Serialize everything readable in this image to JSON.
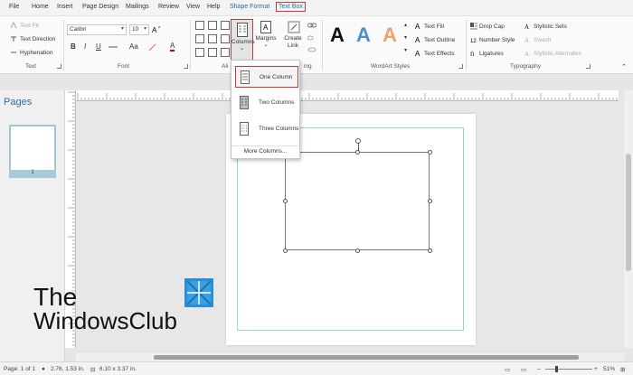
{
  "menu": {
    "file": "File",
    "home": "Home",
    "insert": "Insert",
    "page_design": "Page Design",
    "mailings": "Mailings",
    "review": "Review",
    "view": "View",
    "help": "Help",
    "shape_format": "Shape Format",
    "text_box": "Text Box"
  },
  "ribbon": {
    "text_group": {
      "label": "Text",
      "text_fit": "Text Fit",
      "text_direction": "Text Direction",
      "hyphenation": "Hyphenation"
    },
    "font_group": {
      "label": "Font",
      "font_name": "Calibri",
      "font_size": "10",
      "bold": "B",
      "italic": "I",
      "underline": "U",
      "grow": "A",
      "shrink": "A",
      "clear": "Aa",
      "color": "A"
    },
    "alignment_group": {
      "label": "Ali"
    },
    "columns_button": "Columns",
    "margins_button": "Margins",
    "create_link": "Create Link",
    "linking_label": "ing",
    "wordart_group": {
      "label": "WordArt Styles",
      "samples": [
        "A",
        "A",
        "A"
      ],
      "text_fill": "Text Fill",
      "text_outline": "Text Outline",
      "text_effects": "Text Effects"
    },
    "typography_group": {
      "label": "Typography",
      "drop_cap": "Drop Cap",
      "number_style": "Number Style",
      "ligatures": "Ligatures",
      "stylistic_sets": "Stylistic Sets",
      "swash": "Swash",
      "stylistic_alternates": "Stylistic Alternates"
    }
  },
  "columns_dropdown": {
    "items": [
      {
        "label": "One Column"
      },
      {
        "label": "Two Columns"
      },
      {
        "label": "Three Columns"
      }
    ],
    "more": "More Columns..."
  },
  "pages_pane": {
    "title": "Pages",
    "page_number": "1"
  },
  "status": {
    "page": "Page: 1 of 1",
    "position": "2.76, 1.53 in.",
    "size": "6.10 x 3.37 in.",
    "zoom": "51%"
  },
  "watermark": {
    "line1": "The",
    "line2": "WindowsClub"
  },
  "colors": {
    "accent": "#2b6ea8",
    "highlight": "#c23a3a",
    "guide": "#9ed0d6"
  },
  "icons": [
    "text-fit-icon",
    "text-direction-icon",
    "hyphenation-icon",
    "columns-icon",
    "margins-icon",
    "create-link-icon",
    "text-fill-icon",
    "drop-cap-icon"
  ]
}
